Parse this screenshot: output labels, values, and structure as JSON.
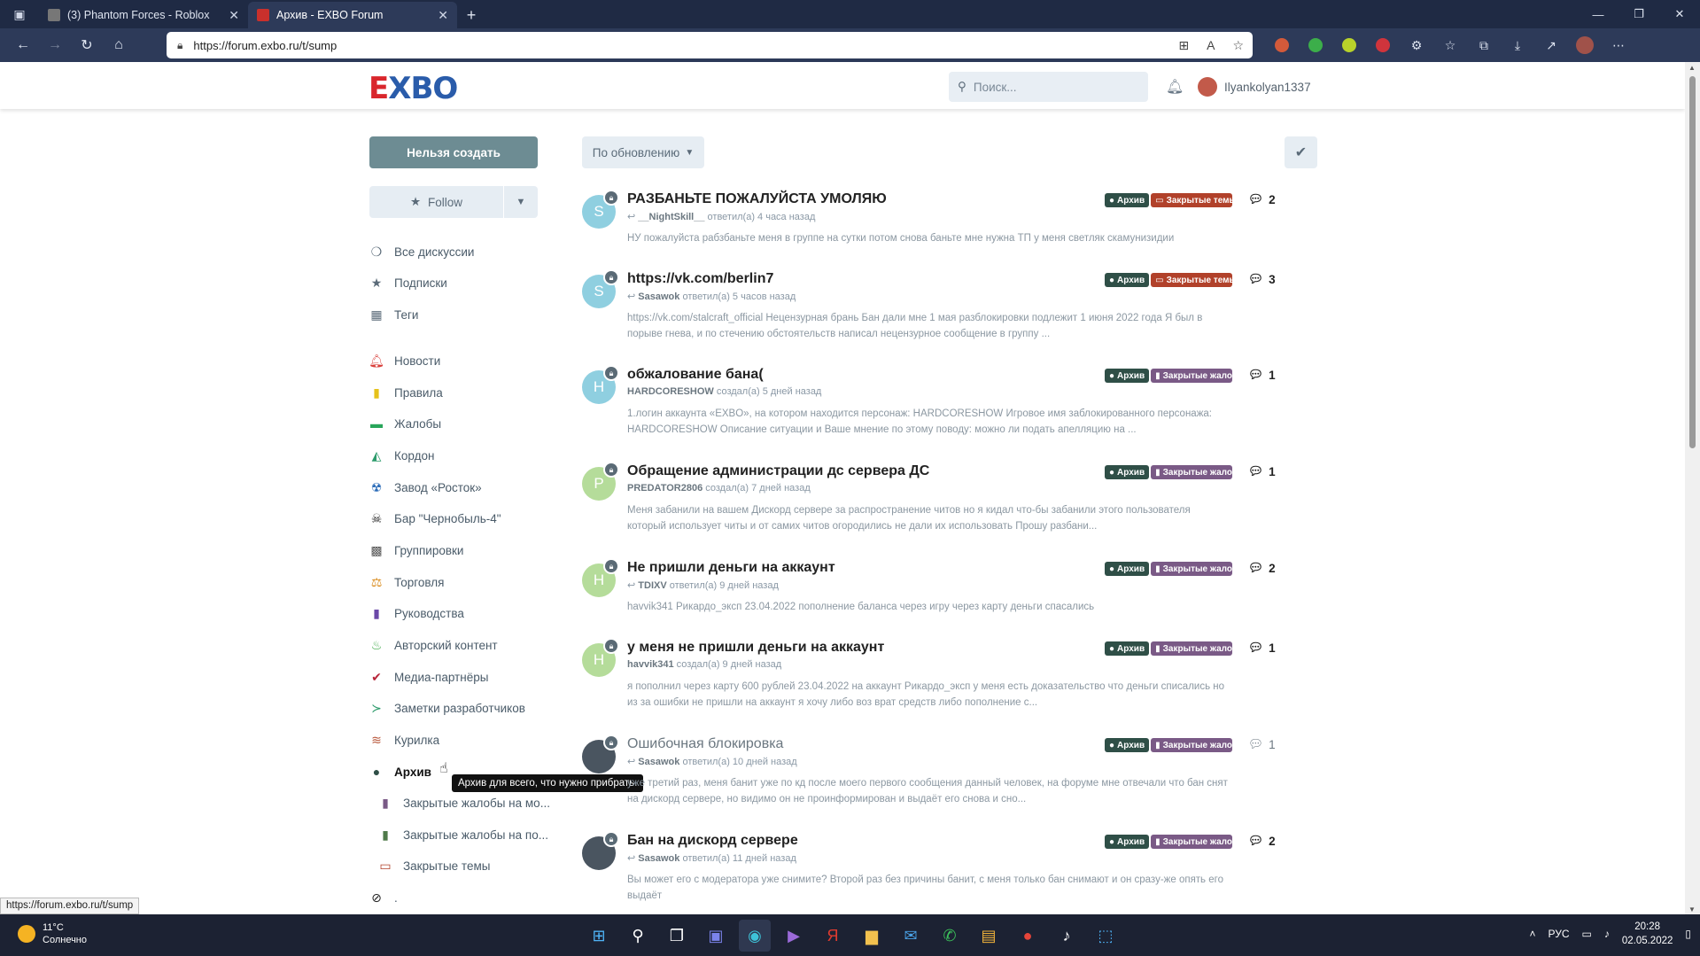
{
  "browser": {
    "tabs": [
      {
        "title": "(3) Phantom Forces - Roblox",
        "active": false
      },
      {
        "title": "Архив - EXBO Forum",
        "active": true
      }
    ],
    "url": "https://forum.exbo.ru/t/sump",
    "status_url": "https://forum.exbo.ru/t/sump"
  },
  "header": {
    "logo_e": "E",
    "logo_rest": "XBO",
    "search_placeholder": "Поиск...",
    "username": "Ilyankolyan1337"
  },
  "sidebar": {
    "create_button": "Нельзя создать",
    "follow_button": "Follow",
    "items": [
      {
        "label": "Все дискуссии",
        "icon": "chat-icon",
        "color": "#5b6b79"
      },
      {
        "label": "Подписки",
        "icon": "star-icon",
        "color": "#5b6b79"
      },
      {
        "label": "Теги",
        "icon": "grid-icon",
        "color": "#5b6b79"
      },
      {
        "label": "Новости",
        "icon": "bell-icon",
        "color": "#d9413c"
      },
      {
        "label": "Правила",
        "icon": "book-icon",
        "color": "#e6c21a"
      },
      {
        "label": "Жалобы",
        "icon": "briefcase-icon",
        "color": "#28a55a"
      },
      {
        "label": "Кордон",
        "icon": "hills-icon",
        "color": "#2c9b6b"
      },
      {
        "label": "Завод «Росток»",
        "icon": "radiation-icon",
        "color": "#2b6cb8"
      },
      {
        "label": "Бар \"Чернобыль-4\"",
        "icon": "skull-icon",
        "color": "#222222"
      },
      {
        "label": "Группировки",
        "icon": "checker-icon",
        "color": "#555555"
      },
      {
        "label": "Торговля",
        "icon": "scales-icon",
        "color": "#d98a1a"
      },
      {
        "label": "Руководства",
        "icon": "book-icon",
        "color": "#6b48a8"
      },
      {
        "label": "Авторский контент",
        "icon": "flame-icon",
        "color": "#3aa845"
      },
      {
        "label": "Медиа-партнёры",
        "icon": "check-icon",
        "color": "#b8263a"
      },
      {
        "label": "Заметки разработчиков",
        "icon": "terminal-icon",
        "color": "#2c9b6b"
      },
      {
        "label": "Курилка",
        "icon": "smoke-icon",
        "color": "#b8563a"
      },
      {
        "label": "Архив",
        "icon": "bomb-icon",
        "color": "#2f4f47"
      },
      {
        "label": "Закрытые жалобы на мо...",
        "icon": "book-icon",
        "color": "#7a5a86"
      },
      {
        "label": "Закрытые жалобы на по...",
        "icon": "book-icon",
        "color": "#4f7a4a"
      },
      {
        "label": "Закрытые темы",
        "icon": "toolbox-icon",
        "color": "#b1412a"
      },
      {
        "label": ".",
        "icon": "eye-slash-icon",
        "color": "#222222"
      }
    ],
    "tooltip": "Архив для всего, что нужно прибрать."
  },
  "toolbar": {
    "sort_label": "По обновлению"
  },
  "tags": {
    "archive": "Архив",
    "themes": "Закрытые темы",
    "complaints": "Закрытые жалобы"
  },
  "discussions": [
    {
      "title": "РАЗБАНЬТЕ ПОЖАЛУЙСТА УМОЛЯЮ",
      "user": "__NightSkill__",
      "action": "ответил(а) 4 часа назад",
      "replied": true,
      "excerpt": "НУ пожалуйста рабзбаньте меня в группе на сутки потом снова баньте мне нужна ТП у меня светляк скамунизидии",
      "count": "2",
      "avatar": "S",
      "avatar_color": "#8fcfe0",
      "tag": "themes",
      "read": false
    },
    {
      "title": "https://vk.com/berlin7",
      "user": "Sasawok",
      "action": "ответил(а) 5 часов назад",
      "replied": true,
      "excerpt": "https://vk.com/stalcraft_official Нецензурная брань Бан дали мне 1 мая разблокировки подлежит 1 июня 2022 года Я был в порыве гнева, и по стечению обстоятельств написал нецензурное сообщение в группу ...",
      "count": "3",
      "avatar": "S",
      "avatar_color": "#8fcfe0",
      "tag": "themes",
      "read": false
    },
    {
      "title": "обжалование бана(",
      "user": "HARDCORESHOW",
      "action": "создал(а) 5 дней назад",
      "replied": false,
      "excerpt": "1.логин аккаунта «EXBO», на котором находится персонаж: HARDCORESHOW Игровое имя заблокированного персонажа: HARDCORESHOW Описание ситуации и Ваше мнение по этому поводу: можно ли подать апелляцию на ...",
      "count": "1",
      "avatar": "H",
      "avatar_color": "#8fcfe0",
      "tag": "complaints",
      "read": false
    },
    {
      "title": "Обращение администрации дс сервера ДС",
      "user": "PREDATOR2806",
      "action": "создал(а) 7 дней назад",
      "replied": false,
      "excerpt": "Меня забанили на вашем Дискорд сервере за распространение читов но я кидал что-бы забанили этого пользователя который использует читы и от самих читов огородились не дали их использовать Прошу разбани...",
      "count": "1",
      "avatar": "P",
      "avatar_color": "#b5dc9a",
      "tag": "complaints",
      "read": false
    },
    {
      "title": "Не пришли деньги на аккаунт",
      "user": "TDIXV",
      "action": "ответил(а) 9 дней назад",
      "replied": true,
      "excerpt": "havvik341 Рикардо_эксп 23.04.2022 пополнение баланса через игру через карту деньги спасались",
      "count": "2",
      "avatar": "H",
      "avatar_color": "#b5dc9a",
      "tag": "complaints",
      "read": false
    },
    {
      "title": "у меня не пришли деньги на аккаунт",
      "user": "havvik341",
      "action": "создал(а) 9 дней назад",
      "replied": false,
      "excerpt": "я пополнил через карту 600 рублей 23.04.2022 на аккаунт Рикардо_эксп у меня есть доказательство что деньги списались но из за ошибки не пришли на аккаунт я хочу либо воз врат средств либо пополнение с...",
      "count": "1",
      "avatar": "H",
      "avatar_color": "#b5dc9a",
      "tag": "complaints",
      "read": false
    },
    {
      "title": "Ошибочная блокировка",
      "user": "Sasawok",
      "action": "ответил(а) 10 дней назад",
      "replied": true,
      "excerpt": "уже третий раз, меня банит уже по кд после моего первого сообщения данный человек, на форуме мне отвечали что бан снят на дискорд сервере, но видимо он не проинформирован и выдаёт его снова и сно...",
      "count": "1",
      "avatar": "",
      "avatar_color": "#4a5560",
      "tag": "complaints",
      "read": true
    },
    {
      "title": "Бан на дискорд сервере",
      "user": "Sasawok",
      "action": "ответил(а) 11 дней назад",
      "replied": true,
      "excerpt": "Вы может его с модератора уже снимите? Второй раз без причины банит, с меня только бан снимают и он сразу-же опять его выдаёт",
      "count": "2",
      "avatar": "",
      "avatar_color": "#4a5560",
      "tag": "complaints",
      "read": false
    }
  ],
  "taskbar": {
    "temperature": "11°C",
    "weather": "Солнечно",
    "lang": "РУС",
    "time": "20:28",
    "date": "02.05.2022"
  }
}
